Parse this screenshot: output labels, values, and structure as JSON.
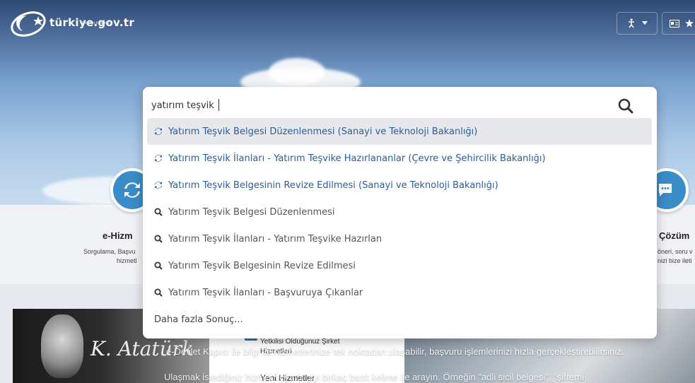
{
  "header": {
    "logo_text": "türkiye.gov.tr",
    "logo_sub": "Devletin Kısayolu",
    "accessibility_icon": "accessibility-icon",
    "profile_icon": "id-card-icon",
    "star_icon": "star-icon"
  },
  "search": {
    "value": "yatırım teşvik",
    "icon": "search-icon"
  },
  "results": [
    {
      "type": "service",
      "label": "Yatırım Teşvik Belgesi Düzenlenmesi (Sanayi ve Teknoloji Bakanlığı)"
    },
    {
      "type": "service",
      "label": "Yatırım Teşvik İlanları - Yatırım Teşvike Hazırlananlar (Çevre ve Şehircilik Bakanlığı)"
    },
    {
      "type": "service",
      "label": "Yatırım Teşvik Belgesinin Revize Edilmesi (Sanayi ve Teknoloji Bakanlığı)"
    },
    {
      "type": "query",
      "label": "Yatırım Teşvik Belgesi Düzenlenmesi"
    },
    {
      "type": "query",
      "label": "Yatırım Teşvik İlanları - Yatırım Teşvike Hazırlan"
    },
    {
      "type": "query",
      "label": "Yatırım Teşvik Belgesinin Revize Edilmesi"
    },
    {
      "type": "query",
      "label": "Yatırım Teşvik İlanları - Başvuruya Çıkanlar"
    }
  ],
  "more_results": "Daha fazla Sonuç...",
  "features": {
    "left_title": "e-Hizm",
    "left_desc_1": "Sorgulama, Başvu",
    "left_desc_2": "hizmetl",
    "right_title": "Çözüm",
    "right_desc_1": "öneri, soru v",
    "right_desc_2": "nizi bize ileti"
  },
  "lower": {
    "signature": "K. Atatürk",
    "card_item_1a": "Yetkilisi Olduğunuz Şirket",
    "card_item_1b": "Hizmetleri",
    "card_item_2": "Yeni Hizmetler",
    "overlay_1": "e-Devlet Kapısı ile bilgi ve hizmetlerinize tek noktadan ulaşabilir, başvuru işlemlerinizi hızla gerçekleştirebilirsiniz.",
    "overlay_2": "Ulaşmak istediğiniz hizmet veya bilgiyi birkaç basit kelime ile arayın. Örneğin \"adli sicil belgesi\", \"şifremi"
  },
  "colors": {
    "brand_blue": "#3a8dc8",
    "result_link": "#2a5d9e"
  }
}
